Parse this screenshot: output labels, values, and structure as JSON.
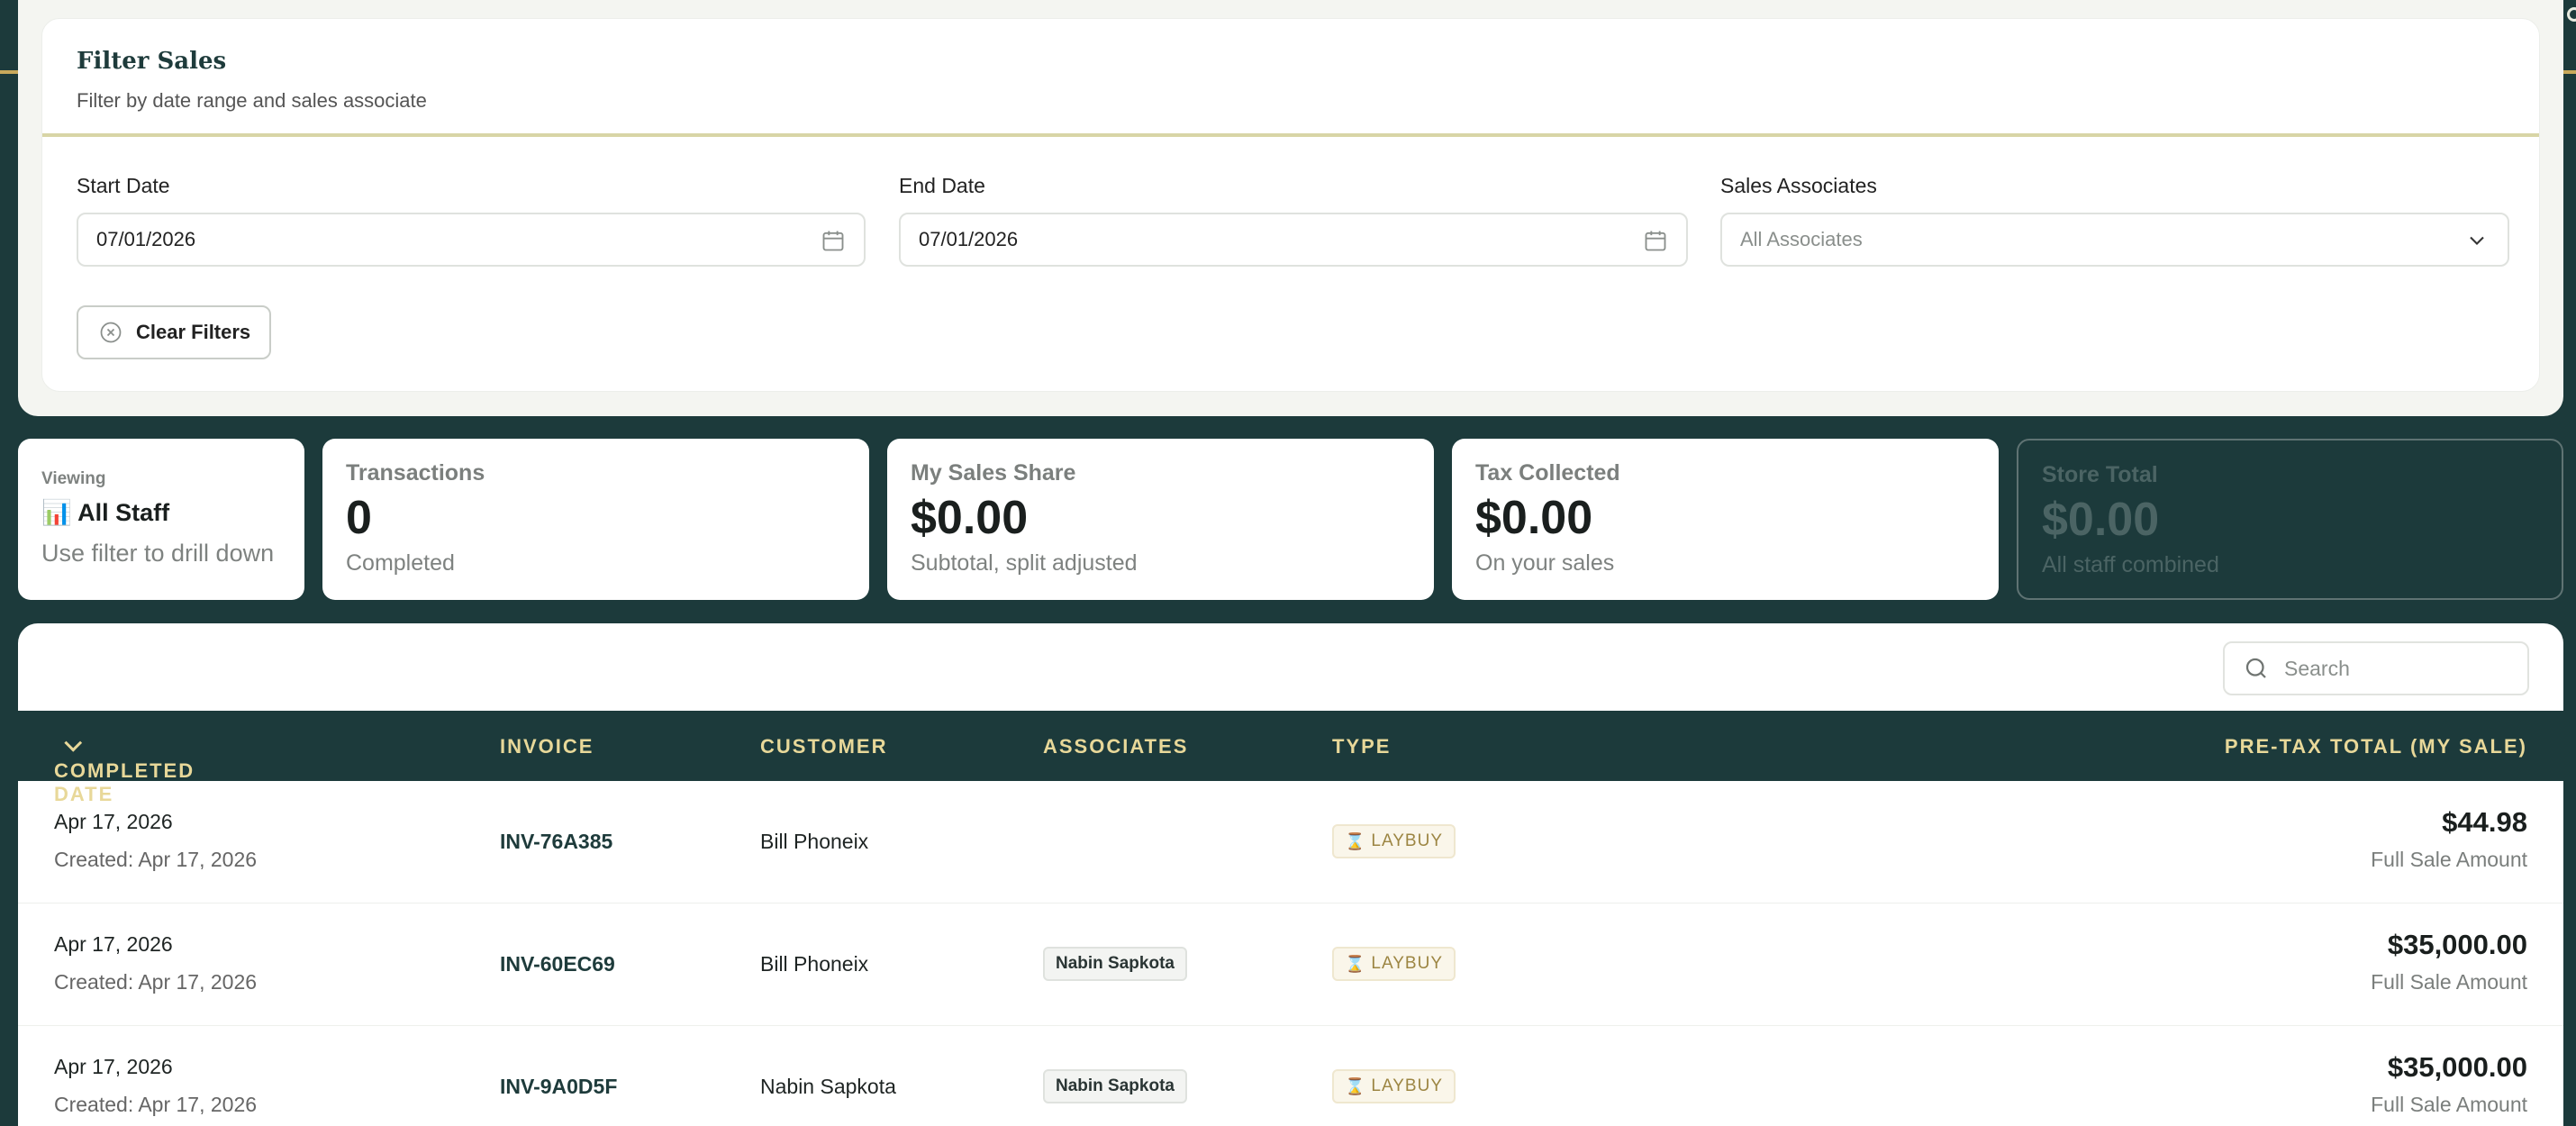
{
  "filters": {
    "title": "Filter Sales",
    "subtitle": "Filter by date range and sales associate",
    "start_date": {
      "label": "Start Date",
      "value": "07/01/2026"
    },
    "end_date": {
      "label": "End Date",
      "value": "07/01/2026"
    },
    "associates": {
      "label": "Sales Associates",
      "placeholder": "All Associates"
    },
    "clear_label": "Clear Filters"
  },
  "stats": {
    "viewing": {
      "key": "Viewing",
      "icon": "📊",
      "who": "All Staff",
      "hint": "Use filter to drill down"
    },
    "transactions": {
      "label": "Transactions",
      "value": "0",
      "note": "Completed"
    },
    "my_share": {
      "label": "My Sales Share",
      "value": "$0.00",
      "note": "Subtotal, split adjusted"
    },
    "tax": {
      "label": "Tax Collected",
      "value": "$0.00",
      "note": "On your sales"
    },
    "store_total": {
      "label": "Store Total",
      "value": "$0.00",
      "note": "All staff combined"
    }
  },
  "table": {
    "search_placeholder": "Search",
    "columns": {
      "completed": "COMPLETED DATE",
      "invoice": "INVOICE",
      "customer": "CUSTOMER",
      "associates": "ASSOCIATES",
      "type": "TYPE",
      "total": "PRE-TAX TOTAL (MY SALE)"
    },
    "rows": [
      {
        "completed": "Apr 17, 2026",
        "created": "Created: Apr 17, 2026",
        "invoice": "INV-76A385",
        "customer": "Bill Phoneix",
        "associate": "",
        "type": "LAYBUY",
        "amount": "$44.98",
        "amount_note": "Full Sale Amount"
      },
      {
        "completed": "Apr 17, 2026",
        "created": "Created: Apr 17, 2026",
        "invoice": "INV-60EC69",
        "customer": "Bill Phoneix",
        "associate": "Nabin Sapkota",
        "type": "LAYBUY",
        "amount": "$35,000.00",
        "amount_note": "Full Sale Amount"
      },
      {
        "completed": "Apr 17, 2026",
        "created": "Created: Apr 17, 2026",
        "invoice": "INV-9A0D5F",
        "customer": "Nabin Sapkota",
        "associate": "Nabin Sapkota",
        "type": "LAYBUY",
        "amount": "$35,000.00",
        "amount_note": "Full Sale Amount"
      }
    ]
  },
  "icons": {
    "type_icon": "⌛"
  }
}
